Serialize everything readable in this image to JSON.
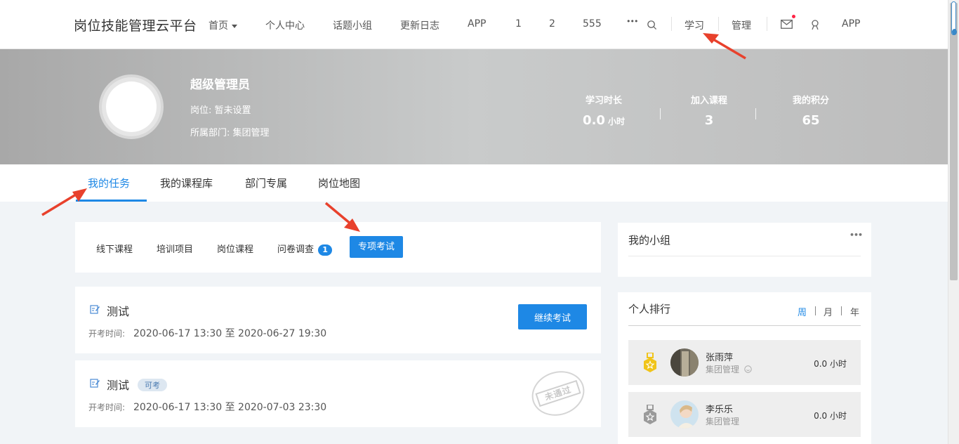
{
  "topnav": {
    "brand": "岗位技能管理云平台",
    "items": [
      "首页",
      "个人中心",
      "话题小组",
      "更新日志",
      "APP",
      "1",
      "2",
      "555"
    ],
    "more": "•••",
    "learn": "学习",
    "manage": "管理",
    "app": "APP"
  },
  "profile": {
    "name": "超级管理员",
    "position": "岗位: 暂未设置",
    "department": "所属部门: 集团管理",
    "stats": [
      {
        "label": "学习时长",
        "value": "0.0",
        "unit": "小时"
      },
      {
        "label": "加入课程",
        "value": "3",
        "unit": ""
      },
      {
        "label": "我的积分",
        "value": "65",
        "unit": ""
      }
    ]
  },
  "tabs": [
    "我的任务",
    "我的课程库",
    "部门专属",
    "岗位地图"
  ],
  "subtabs": {
    "items": [
      "线下课程",
      "培训项目",
      "岗位课程",
      "问卷调查"
    ],
    "survey_badge": "1",
    "active": "专项考试"
  },
  "exams": [
    {
      "title": "测试",
      "tag": "",
      "time_label": "开考时间:",
      "time": "2020-06-17 13:30 至 2020-06-27 19:30",
      "action": "继续考试",
      "stamp": ""
    },
    {
      "title": "测试",
      "tag": "可考",
      "time_label": "开考时间:",
      "time": "2020-06-17 13:30 至 2020-07-03 23:30",
      "action": "",
      "stamp": "未通过"
    }
  ],
  "my_group": {
    "title": "我的小组",
    "more": "•••"
  },
  "ranking": {
    "title": "个人排行",
    "periods": [
      "周",
      "月",
      "年"
    ],
    "items": [
      {
        "name": "张雨萍",
        "dept": "集团管理",
        "hours": "0.0 小时",
        "medal_color": "#f0c419"
      },
      {
        "name": "李乐乐",
        "dept": "集团管理",
        "hours": "0.0 小时",
        "medal_color": "#9a9a9a"
      }
    ]
  },
  "colors": {
    "accent": "#1e88e5",
    "arrow": "#e8412c"
  }
}
